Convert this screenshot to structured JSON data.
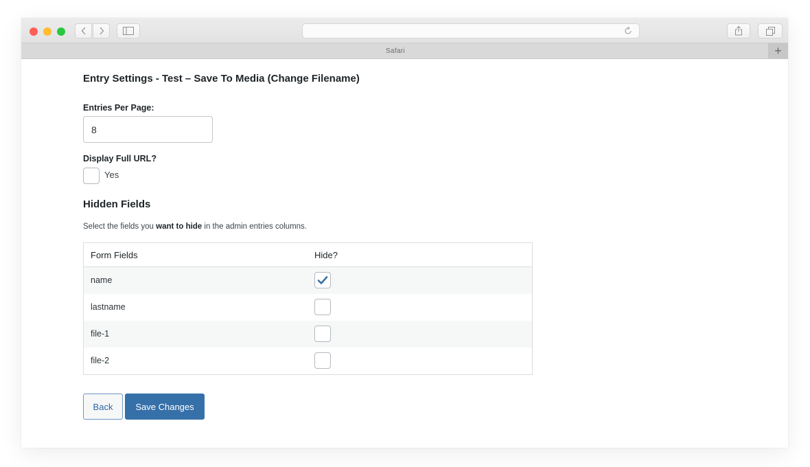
{
  "browser": {
    "app_name": "Safari",
    "tab_title": "Safari",
    "address_value": "",
    "new_tab_label": "+",
    "icons": {
      "back": "chevron-left-icon",
      "forward": "chevron-right-icon",
      "sidebar": "sidebar-icon",
      "reload": "reload-icon",
      "share": "share-icon",
      "tabs": "tabs-overview-icon"
    }
  },
  "page": {
    "title": "Entry Settings - Test – Save To Media (Change Filename)",
    "entries_per_page": {
      "label": "Entries Per Page:",
      "value": "8"
    },
    "display_full_url": {
      "label": "Display Full URL?",
      "option_label": "Yes",
      "checked": false
    },
    "hidden_fields": {
      "title": "Hidden Fields",
      "description_before": "Select the fields you ",
      "description_bold": "want to hide",
      "description_after": " in the admin entries columns.",
      "table": {
        "headers": [
          "Form Fields",
          "Hide?"
        ],
        "rows": [
          {
            "field": "name",
            "hidden": true
          },
          {
            "field": "lastname",
            "hidden": false
          },
          {
            "field": "file-1",
            "hidden": false
          },
          {
            "field": "file-2",
            "hidden": false
          }
        ]
      }
    },
    "buttons": {
      "back": "Back",
      "save": "Save Changes"
    },
    "colors": {
      "primary": "#3670a9",
      "checkmark": "#3670a9",
      "row_alt": "#f6f7f7"
    }
  }
}
